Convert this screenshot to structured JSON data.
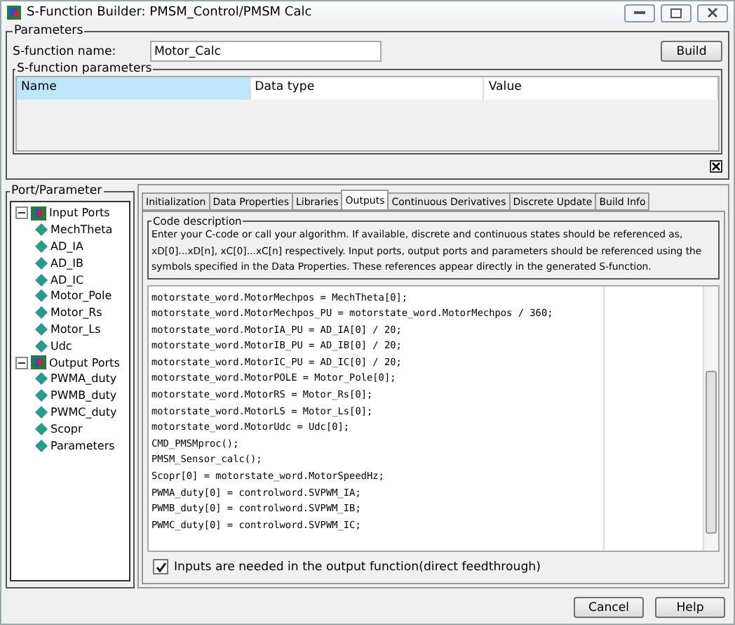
{
  "window": {
    "title": "S-Function Builder: PMSM_Control/PMSM Calc"
  },
  "parameters": {
    "title": "Parameters",
    "name_label": "S-function name:",
    "name_value": "Motor_Calc",
    "build_button": "Build",
    "table": {
      "title": "S-function parameters",
      "columns": [
        {
          "label": "Name",
          "selected": true
        },
        {
          "label": "Data type",
          "selected": false
        },
        {
          "label": "Value",
          "selected": false
        }
      ]
    }
  },
  "port_parameter": {
    "title": "Port/Parameter",
    "tree": [
      {
        "label": "Input Ports",
        "kind": "folder",
        "expanded": true,
        "children": [
          {
            "label": "MechTheta",
            "kind": "port"
          },
          {
            "label": "AD_IA",
            "kind": "port"
          },
          {
            "label": "AD_IB",
            "kind": "port"
          },
          {
            "label": "AD_IC",
            "kind": "port"
          },
          {
            "label": "Motor_Pole",
            "kind": "port"
          },
          {
            "label": "Motor_Rs",
            "kind": "port"
          },
          {
            "label": "Motor_Ls",
            "kind": "port"
          },
          {
            "label": "Udc",
            "kind": "port"
          }
        ]
      },
      {
        "label": "Output Ports",
        "kind": "folder",
        "expanded": true,
        "children": [
          {
            "label": "PWMA_duty",
            "kind": "port"
          },
          {
            "label": "PWMB_duty",
            "kind": "port"
          },
          {
            "label": "PWMC_duty",
            "kind": "port"
          },
          {
            "label": "Scopr",
            "kind": "port"
          }
        ]
      },
      {
        "label": "Parameters",
        "kind": "port"
      }
    ]
  },
  "tabs": [
    {
      "label": "Initialization",
      "selected": false
    },
    {
      "label": "Data Properties",
      "selected": false
    },
    {
      "label": "Libraries",
      "selected": false
    },
    {
      "label": "Outputs",
      "selected": true
    },
    {
      "label": "Continuous Derivatives",
      "selected": false
    },
    {
      "label": "Discrete Update",
      "selected": false
    },
    {
      "label": "Build Info",
      "selected": false
    }
  ],
  "code_description": {
    "title": "Code description",
    "text": "Enter your C-code or call your algorithm. If available, discrete and continuous states should be referenced as, xD[0]...xD[n], xC[0]...xC[n] respectively. Input ports, output ports and parameters should be referenced using the symbols specified in the Data Properties. These references appear directly in the generated S-function."
  },
  "code_lines": [
    "motorstate_word.MotorMechpos = MechTheta[0];",
    "motorstate_word.MotorMechpos_PU = motorstate_word.MotorMechpos / 360;",
    "motorstate_word.MotorIA_PU = AD_IA[0] / 20;",
    "motorstate_word.MotorIB_PU = AD_IB[0] / 20;",
    "motorstate_word.MotorIC_PU = AD_IC[0] / 20;",
    "motorstate_word.MotorPOLE = Motor_Pole[0];",
    "motorstate_word.MotorRS = Motor_Rs[0];",
    "motorstate_word.MotorLS = Motor_Ls[0];",
    "motorstate_word.MotorUdc = Udc[0];",
    "CMD_PMSMproc();",
    "PMSM_Sensor_calc();",
    "Scopr[0] = motorstate_word.MotorSpeedHz;",
    "PWMA_duty[0] = controlword.SVPWM_IA;",
    "PWMB_duty[0] = controlword.SVPWM_IB;",
    "PWMC_duty[0] = controlword.SVPWM_IC;"
  ],
  "feedthrough": {
    "label": "Inputs are needed in the output function(direct feedthrough)",
    "checked": true
  },
  "buttons": [
    "Cancel",
    "Help"
  ]
}
